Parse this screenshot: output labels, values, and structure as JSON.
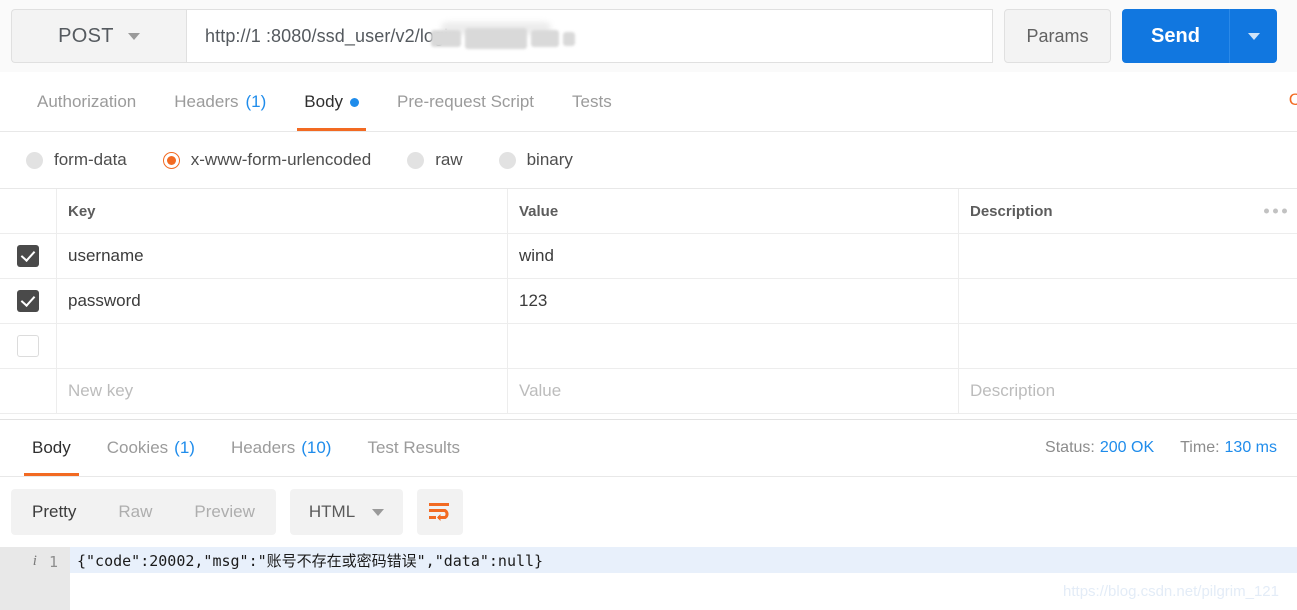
{
  "request": {
    "method": "POST",
    "url": "http://1                  :8080/ssd_user/v2/login",
    "url_prefix": "http://1",
    "url_suffix": ":8080/ssd_user/v2/login",
    "params_label": "Params",
    "send_label": "Send",
    "tabs": [
      {
        "label": "Authorization",
        "count": "",
        "active": false,
        "dot": false
      },
      {
        "label": "Headers",
        "count": "(1)",
        "active": false,
        "dot": false
      },
      {
        "label": "Body",
        "count": "",
        "active": true,
        "dot": true
      },
      {
        "label": "Pre-request Script",
        "count": "",
        "active": false,
        "dot": false
      },
      {
        "label": "Tests",
        "count": "",
        "active": false,
        "dot": false
      }
    ],
    "code_link": "C",
    "body_types": [
      {
        "label": "form-data",
        "selected": false
      },
      {
        "label": "x-www-form-urlencoded",
        "selected": true
      },
      {
        "label": "raw",
        "selected": false
      },
      {
        "label": "binary",
        "selected": false
      }
    ]
  },
  "params_table": {
    "headers": {
      "key": "Key",
      "value": "Value",
      "description": "Description"
    },
    "rows": [
      {
        "checked": true,
        "key": "username",
        "value": "wind",
        "description": ""
      },
      {
        "checked": true,
        "key": "password",
        "value": "123",
        "description": ""
      },
      {
        "checked": false,
        "key": "",
        "value": "",
        "description": ""
      }
    ],
    "new_row": {
      "key": "New key",
      "value": "Value",
      "description": "Description"
    }
  },
  "response": {
    "tabs": [
      {
        "label": "Body",
        "count": "",
        "active": true
      },
      {
        "label": "Cookies",
        "count": "(1)",
        "active": false
      },
      {
        "label": "Headers",
        "count": "(10)",
        "active": false
      },
      {
        "label": "Test Results",
        "count": "",
        "active": false
      }
    ],
    "status_label": "Status:",
    "status_value": "200 OK",
    "time_label": "Time:",
    "time_value": "130 ms",
    "view_modes": [
      {
        "label": "Pretty",
        "active": true
      },
      {
        "label": "Raw",
        "active": false
      },
      {
        "label": "Preview",
        "active": false
      }
    ],
    "format": "HTML",
    "line_number": "1",
    "body_text": "{\"code\":20002,\"msg\":\"账号不存在或密码错误\",\"data\":null}"
  },
  "watermark": "https://blog.csdn.net/pilgrim_121",
  "colors": {
    "accent_orange": "#f26a22",
    "accent_blue": "#1f8ceb",
    "send_blue": "#1177e0"
  }
}
